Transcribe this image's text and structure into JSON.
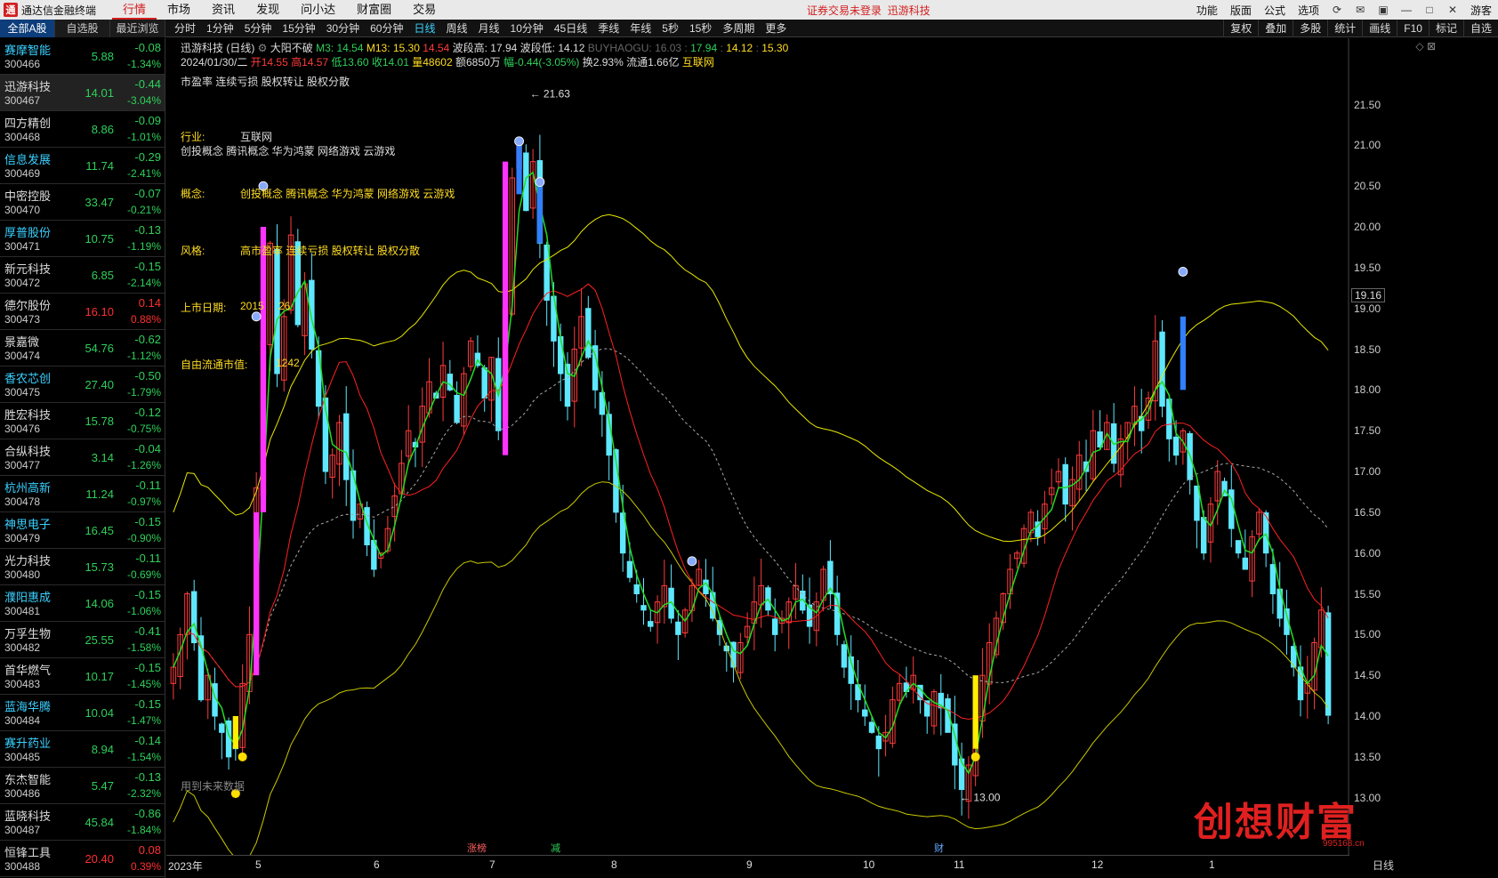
{
  "app": {
    "logo_text": "通",
    "title": "通达信金融终端"
  },
  "menu": [
    "行情",
    "市场",
    "资讯",
    "发现",
    "问小达",
    "财富圈",
    "交易"
  ],
  "login_status": "证券交易未登录",
  "login_stock": "迅游科技",
  "menubar_right": [
    "功能",
    "版面",
    "公式",
    "选项"
  ],
  "guest_label": "游客",
  "list_tabs": [
    "全部A股",
    "自选股",
    "最近浏览"
  ],
  "period_tabs": [
    "分时",
    "1分钟",
    "5分钟",
    "15分钟",
    "30分钟",
    "60分钟",
    "日线",
    "周线",
    "月线",
    "10分钟",
    "45日线",
    "季线",
    "年线",
    "5秒",
    "15秒",
    "多周期",
    "更多"
  ],
  "active_period": "日线",
  "chart_tools": [
    "复权",
    "叠加",
    "多股",
    "统计",
    "画线",
    "F10",
    "标记",
    "自选"
  ],
  "stocks": [
    {
      "name": "赛摩智能",
      "code": "300466",
      "price": "5.88",
      "chg": "-0.08",
      "pct": "-1.34%",
      "dir": "dn",
      "hl": true
    },
    {
      "name": "迅游科技",
      "code": "300467",
      "price": "14.01",
      "chg": "-0.44",
      "pct": "-3.04%",
      "dir": "dn",
      "hl": false,
      "selected": true
    },
    {
      "name": "四方精创",
      "code": "300468",
      "price": "8.86",
      "chg": "-0.09",
      "pct": "-1.01%",
      "dir": "dn",
      "hl": false
    },
    {
      "name": "信息发展",
      "code": "300469",
      "price": "11.74",
      "chg": "-0.29",
      "pct": "-2.41%",
      "dir": "dn",
      "hl": true
    },
    {
      "name": "中密控股",
      "code": "300470",
      "price": "33.47",
      "chg": "-0.07",
      "pct": "-0.21%",
      "dir": "dn",
      "hl": false
    },
    {
      "name": "厚普股份",
      "code": "300471",
      "price": "10.75",
      "chg": "-0.13",
      "pct": "-1.19%",
      "dir": "dn",
      "hl": true
    },
    {
      "name": "新元科技",
      "code": "300472",
      "price": "6.85",
      "chg": "-0.15",
      "pct": "-2.14%",
      "dir": "dn",
      "hl": false
    },
    {
      "name": "德尔股份",
      "code": "300473",
      "price": "16.10",
      "chg": "0.14",
      "pct": "0.88%",
      "dir": "up",
      "hl": false
    },
    {
      "name": "景嘉微",
      "code": "300474",
      "price": "54.76",
      "chg": "-0.62",
      "pct": "-1.12%",
      "dir": "dn",
      "hl": false
    },
    {
      "name": "香农芯创",
      "code": "300475",
      "price": "27.40",
      "chg": "-0.50",
      "pct": "-1.79%",
      "dir": "dn",
      "hl": true
    },
    {
      "name": "胜宏科技",
      "code": "300476",
      "price": "15.78",
      "chg": "-0.12",
      "pct": "-0.75%",
      "dir": "dn",
      "hl": false
    },
    {
      "name": "合纵科技",
      "code": "300477",
      "price": "3.14",
      "chg": "-0.04",
      "pct": "-1.26%",
      "dir": "dn",
      "hl": false
    },
    {
      "name": "杭州高新",
      "code": "300478",
      "price": "11.24",
      "chg": "-0.11",
      "pct": "-0.97%",
      "dir": "dn",
      "hl": true
    },
    {
      "name": "神思电子",
      "code": "300479",
      "price": "16.45",
      "chg": "-0.15",
      "pct": "-0.90%",
      "dir": "dn",
      "hl": true
    },
    {
      "name": "光力科技",
      "code": "300480",
      "price": "15.73",
      "chg": "-0.11",
      "pct": "-0.69%",
      "dir": "dn",
      "hl": false
    },
    {
      "name": "濮阳惠成",
      "code": "300481",
      "price": "14.06",
      "chg": "-0.15",
      "pct": "-1.06%",
      "dir": "dn",
      "hl": true
    },
    {
      "name": "万孚生物",
      "code": "300482",
      "price": "25.55",
      "chg": "-0.41",
      "pct": "-1.58%",
      "dir": "dn",
      "hl": false
    },
    {
      "name": "首华燃气",
      "code": "300483",
      "price": "10.17",
      "chg": "-0.15",
      "pct": "-1.45%",
      "dir": "dn",
      "hl": false
    },
    {
      "name": "蓝海华腾",
      "code": "300484",
      "price": "10.04",
      "chg": "-0.15",
      "pct": "-1.47%",
      "dir": "dn",
      "hl": true
    },
    {
      "name": "赛升药业",
      "code": "300485",
      "price": "8.94",
      "chg": "-0.14",
      "pct": "-1.54%",
      "dir": "dn",
      "hl": true
    },
    {
      "name": "东杰智能",
      "code": "300486",
      "price": "5.47",
      "chg": "-0.13",
      "pct": "-2.32%",
      "dir": "dn",
      "hl": false
    },
    {
      "name": "蓝晓科技",
      "code": "300487",
      "price": "45.84",
      "chg": "-0.86",
      "pct": "-1.84%",
      "dir": "dn",
      "hl": false
    },
    {
      "name": "恒锋工具",
      "code": "300488",
      "price": "20.40",
      "chg": "0.08",
      "pct": "0.39%",
      "dir": "up",
      "hl": false
    }
  ],
  "header": {
    "title": "迅游科技 (日线)",
    "indicator": "大阳不破",
    "m3_label": "M3: 14.54",
    "m13_label": "M13: 15.30",
    "m13_last": "14.54",
    "wave_high_label": "波段高: 17.94",
    "wave_low_label": "波段低: 14.12",
    "buy_label": "BUYHAOGU: 16.03",
    "buy_vals": [
      "17.94",
      "14.12",
      "15.30"
    ],
    "date": "2024/01/30/二",
    "open": "开14.55",
    "high": "高14.57",
    "low": "低13.60",
    "close": "收14.01",
    "volume": "量48602",
    "amount": "额6850万",
    "change": "幅-0.44(-3.05%)",
    "turnover": "换2.93%",
    "float": "流通1.66亿",
    "industry_tag": "互联网"
  },
  "info": {
    "top_text": "市盈率 连续亏损 股权转让 股权分散",
    "industry_label": "行业:",
    "industry_value": "互联网",
    "industry_concepts": "创投概念 腾讯概念 华为鸿蒙 网络游戏 云游戏",
    "concept_label": "概念:",
    "concept_value": "创投概念 腾讯概念 华为鸿蒙 网络游戏 云游戏",
    "style_label": "风格:",
    "style_value": "高市盈率 连续亏损 股权转让 股权分散",
    "list_date_label": "上市日期:",
    "list_date_value": "2015",
    "list_date_tail": "26",
    "float_value_label": "自由流通市值:",
    "float_value_value": "1242"
  },
  "price_ticks": [
    "21.50",
    "21.00",
    "20.50",
    "20.00",
    "19.50",
    "19.00",
    "18.50",
    "18.00",
    "17.50",
    "17.00",
    "16.50",
    "16.00",
    "15.50",
    "15.00",
    "14.50",
    "14.00",
    "13.50",
    "13.00"
  ],
  "current_price_tag": "19.16",
  "date_ticks": [
    "2023年",
    "5",
    "6",
    "7",
    "8",
    "9",
    "10",
    "11",
    "12",
    "1"
  ],
  "date_axis_right": "日线",
  "annotations": {
    "peak": "21.63",
    "trough": "13.00",
    "future_data": "用到未来数据",
    "event_zt": "涨榜",
    "event_jian": "减",
    "event_cai": "财"
  },
  "watermark": "创想财富",
  "watermark_url": "995168.cn",
  "chart_data": {
    "type": "candlestick",
    "ylim": [
      12.8,
      21.8
    ],
    "note_series": [
      "M3",
      "M13",
      "MA",
      "upper band",
      "lower band"
    ],
    "colors": {
      "up": "#ff3b3b",
      "down": "#5ee8ff",
      "m3": "#22dd22",
      "ma": "#ff2020",
      "band_upper": "#e8e800",
      "band_lower": "#c8c800",
      "band_mid": "#aaaaaa",
      "signal_pink": "#ff33ff",
      "signal_blue": "#2f7fff",
      "signal_yellow": "#ffee00"
    },
    "closes": [
      14.6,
      15.0,
      15.5,
      14.9,
      14.2,
      14.5,
      14.0,
      13.8,
      13.5,
      13.6,
      14.4,
      15.0,
      16.8,
      18.6,
      19.8,
      18.2,
      18.9,
      19.9,
      18.8,
      19.3,
      18.5,
      17.8,
      17.0,
      17.2,
      17.6,
      16.9,
      16.4,
      16.6,
      16.1,
      15.8,
      16.0,
      16.3,
      16.7,
      17.1,
      17.5,
      17.3,
      17.8,
      18.1,
      17.9,
      18.3,
      18.0,
      17.6,
      18.2,
      18.6,
      18.3,
      17.9,
      18.4,
      17.5,
      19.0,
      20.6,
      21.0,
      20.2,
      20.8,
      19.8,
      19.1,
      18.6,
      18.2,
      17.8,
      18.5,
      18.9,
      18.4,
      18.0,
      17.7,
      17.2,
      16.5,
      16.0,
      15.7,
      15.5,
      15.3,
      15.1,
      15.4,
      15.6,
      15.2,
      15.0,
      15.3,
      15.6,
      15.8,
      15.5,
      15.2,
      15.0,
      14.8,
      14.6,
      14.9,
      15.1,
      15.4,
      15.6,
      15.3,
      15.0,
      15.2,
      15.4,
      15.6,
      15.3,
      15.1,
      15.4,
      15.8,
      15.5,
      15.0,
      14.6,
      14.4,
      14.2,
      14.0,
      13.8,
      13.6,
      13.8,
      14.2,
      14.4,
      14.3,
      14.5,
      14.2,
      14.0,
      14.3,
      14.1,
      13.8,
      13.4,
      13.1,
      13.4,
      14.0,
      14.5,
      14.9,
      15.2,
      15.5,
      15.8,
      16.0,
      16.3,
      16.5,
      16.2,
      16.6,
      16.8,
      17.0,
      16.6,
      16.9,
      17.2,
      17.0,
      17.5,
      17.3,
      17.6,
      17.1,
      17.4,
      17.6,
      17.8,
      17.5,
      17.9,
      18.6,
      17.8,
      17.4,
      17.2,
      17.5,
      16.9,
      16.4,
      16.0,
      16.6,
      17.0,
      16.7,
      16.3,
      16.0,
      15.8,
      16.2,
      16.5,
      16.0,
      15.5,
      15.2,
      15.0,
      14.6,
      14.2,
      14.4,
      14.9,
      15.3,
      14.01
    ],
    "peak_value": 21.63,
    "trough_value": 13.0
  }
}
